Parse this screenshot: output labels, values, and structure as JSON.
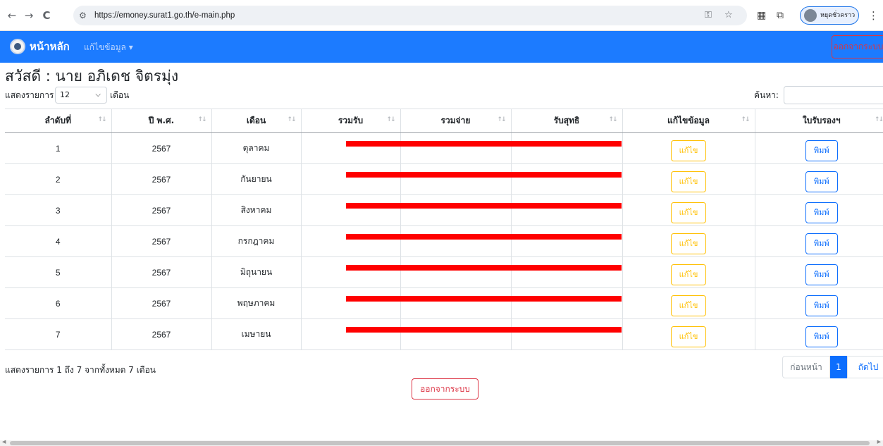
{
  "browser": {
    "back_icon": "←",
    "forward_icon": "→",
    "reload_icon": "C",
    "url": "https://emoney.surat1.go.th/e-main.php",
    "profile_name": "หยุดชั่วคราว"
  },
  "navbar": {
    "brand": "หน้าหลัก",
    "menu": "แก้ไขข้อมูล ▾",
    "logout": "ออกจากระบบ",
    "color": "#1c7bff"
  },
  "greeting": "สวัสดี : นาย อภิเดช จิตรมุ่ง",
  "length": {
    "label_before": "แสดงรายการ",
    "value": "12",
    "label_after": "เดือน"
  },
  "search": {
    "label": "ค้นหา:",
    "placeholder": ""
  },
  "table": {
    "headers": [
      "ลำดับที่",
      "ปี พ.ศ.",
      "เดือน",
      "รวมรับ",
      "รวมจ่าย",
      "รับสุทธิ",
      "แก้ไขข้อมูล",
      "ใบรับรองฯ"
    ],
    "edit_label": "แก้ไข",
    "print_label": "พิมพ์",
    "rows": [
      {
        "no": "1",
        "year": "2567",
        "month": "ตุลาคม"
      },
      {
        "no": "2",
        "year": "2567",
        "month": "กันยายน"
      },
      {
        "no": "3",
        "year": "2567",
        "month": "สิงหาคม"
      },
      {
        "no": "4",
        "year": "2567",
        "month": "กรกฎาคม"
      },
      {
        "no": "5",
        "year": "2567",
        "month": "มิถุนายน"
      },
      {
        "no": "6",
        "year": "2567",
        "month": "พฤษภาคม"
      },
      {
        "no": "7",
        "year": "2567",
        "month": "เมษายน"
      }
    ]
  },
  "footer": {
    "info": "แสดงรายการ 1 ถึง 7 จากทั้งหมด 7 เดือน",
    "prev": "ก่อนหน้า",
    "current_page": "1",
    "next": "ถัดไป",
    "logout": "ออกจากระบบ"
  }
}
